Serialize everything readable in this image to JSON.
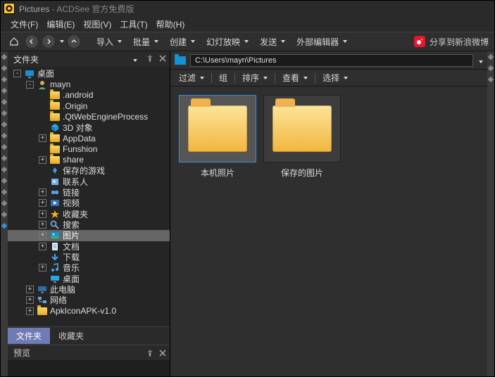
{
  "title": {
    "app": "Pictures",
    "suffix": " - ACDSee 官方免费版"
  },
  "menubar": [
    "文件(F)",
    "编辑(E)",
    "视图(V)",
    "工具(T)",
    "帮助(H)"
  ],
  "toolbar": {
    "menus": [
      "导入",
      "批量",
      "创建",
      "幻灯放映",
      "发送",
      "外部编辑器"
    ],
    "share": "分享到新浪微博"
  },
  "sidebar": {
    "title": "文件夹",
    "tabs": {
      "folders": "文件夹",
      "favorites": "收藏夹"
    },
    "preview": "预览",
    "tree": [
      {
        "d": 0,
        "exp": "-",
        "icon": "monitor",
        "label": "桌面"
      },
      {
        "d": 1,
        "exp": "-",
        "icon": "user",
        "label": "mayn"
      },
      {
        "d": 2,
        "exp": "",
        "icon": "fold",
        "label": ".android"
      },
      {
        "d": 2,
        "exp": "",
        "icon": "fold",
        "label": ".Origin"
      },
      {
        "d": 2,
        "exp": "",
        "icon": "fold",
        "label": ".QtWebEngineProcess"
      },
      {
        "d": 2,
        "exp": "",
        "icon": "cube",
        "label": "3D 对象"
      },
      {
        "d": 2,
        "exp": "+",
        "icon": "fold",
        "label": "AppData"
      },
      {
        "d": 2,
        "exp": "",
        "icon": "fold",
        "label": "Funshion"
      },
      {
        "d": 2,
        "exp": "+",
        "icon": "fold",
        "label": "share"
      },
      {
        "d": 2,
        "exp": "",
        "icon": "game",
        "label": "保存的游戏"
      },
      {
        "d": 2,
        "exp": "",
        "icon": "contact",
        "label": "联系人"
      },
      {
        "d": 2,
        "exp": "+",
        "icon": "link",
        "label": "链接"
      },
      {
        "d": 2,
        "exp": "+",
        "icon": "video",
        "label": "视频"
      },
      {
        "d": 2,
        "exp": "+",
        "icon": "star",
        "label": "收藏夹"
      },
      {
        "d": 2,
        "exp": "+",
        "icon": "search",
        "label": "搜索"
      },
      {
        "d": 2,
        "exp": "+",
        "icon": "pic",
        "label": "图片",
        "sel": true
      },
      {
        "d": 2,
        "exp": "+",
        "icon": "doc",
        "label": "文档"
      },
      {
        "d": 2,
        "exp": "",
        "icon": "down",
        "label": "下载"
      },
      {
        "d": 2,
        "exp": "+",
        "icon": "music",
        "label": "音乐"
      },
      {
        "d": 2,
        "exp": "",
        "icon": "desk",
        "label": "桌面"
      },
      {
        "d": 1,
        "exp": "+",
        "icon": "pc",
        "label": "此电脑"
      },
      {
        "d": 1,
        "exp": "+",
        "icon": "net",
        "label": "网络"
      },
      {
        "d": 1,
        "exp": "+",
        "icon": "fold",
        "label": "ApkIconAPK-v1.0"
      }
    ]
  },
  "main": {
    "path": "C:\\Users\\mayn\\Pictures",
    "filters": [
      "过滤",
      "组",
      "排序",
      "查看",
      "选择"
    ],
    "thumbs": [
      {
        "label": "本机照片",
        "sel": true
      },
      {
        "label": "保存的图片",
        "sel": false
      }
    ]
  }
}
